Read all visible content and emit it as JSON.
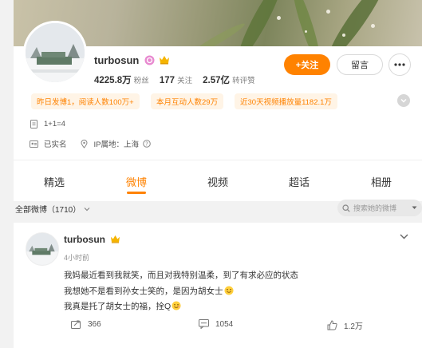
{
  "profile": {
    "username": "turbosun",
    "stats": [
      {
        "value": "4225.8万",
        "label": "粉丝"
      },
      {
        "value": "177",
        "label": "关注"
      },
      {
        "value": "2.57亿",
        "label": "转评赞"
      }
    ],
    "follow_label": "+关注",
    "message_label": "留言",
    "tags": [
      "昨日发博1，阅读人数100万+",
      "本月互动人数29万",
      "近30天视频播放量1182.1万"
    ],
    "bio": "1+1=4",
    "verified_text": "已实名",
    "ip_location": "IP属地：上海"
  },
  "tabs": [
    {
      "label": "精选",
      "active": false
    },
    {
      "label": "微博",
      "active": true
    },
    {
      "label": "视频",
      "active": false
    },
    {
      "label": "超话",
      "active": false
    },
    {
      "label": "相册",
      "active": false
    }
  ],
  "filter": {
    "label": "全部微博（1710）",
    "search_placeholder": "搜索她的微博"
  },
  "post": {
    "username": "turbosun",
    "time": "4小时前",
    "lines": [
      "我妈最近看到我就笑，而且对我特别温柔，到了有求必应的状态",
      "我想她不是看到孙女士笑的，是因为胡女士",
      "我真是托了胡女士的福，拴Q"
    ],
    "reposts": "366",
    "comments": "1054",
    "likes": "1.2万"
  },
  "colors": {
    "accent": "#ff8200",
    "tag_bg": "#fff4e6",
    "page_bg": "#f2f2f2"
  }
}
